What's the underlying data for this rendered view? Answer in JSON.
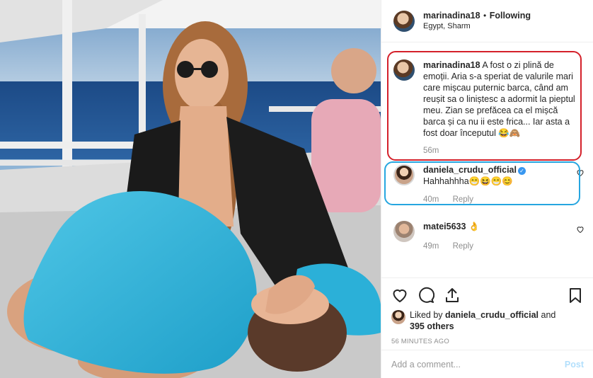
{
  "post": {
    "username": "marinadina18",
    "dot": "•",
    "following_label": "Following",
    "location": "Egypt, Sharm"
  },
  "comments": [
    {
      "username": "marinadina18",
      "text": "A fost o zi plină de emoții. Aria s-a speriat de valurile mari care mișcau puternic barca, când am reușit sa o liniștesc a adormit la pieptul meu. Zian se prefăcea ca el mișcă barca și ca nu ii este frica... Iar asta a fost doar începutul 😂🙈",
      "time": "56m"
    },
    {
      "username": "daniela_crudu_official",
      "verified": true,
      "text": "Hahhahhha😁😆😁😊",
      "time": "40m",
      "reply_label": "Reply"
    },
    {
      "username": "matei5633",
      "text": "👌",
      "time": "49m",
      "reply_label": "Reply"
    }
  ],
  "likes": {
    "prefix": "Liked by",
    "user": "daniela_crudu_official",
    "and": "and",
    "others": "395 others"
  },
  "timestamp": "56 MINUTES AGO",
  "add_comment": {
    "placeholder": "Add a comment...",
    "post_label": "Post"
  },
  "icons": {
    "like": "heart-icon",
    "comment": "comment-icon",
    "share": "share-icon",
    "save": "bookmark-icon"
  },
  "colors": {
    "highlight_red": "#d4202a",
    "highlight_blue": "#26a6e0",
    "verified": "#3897f0",
    "post_disabled": "#b2dffc"
  }
}
